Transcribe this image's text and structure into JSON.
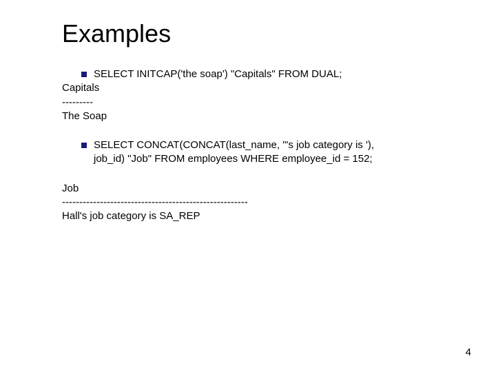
{
  "title": "Examples",
  "block1": {
    "bullet_text": "SELECT INITCAP('the soap') \"Capitals\" FROM DUAL;",
    "line1": "Capitals",
    "line2": "---------",
    "line3": "The Soap"
  },
  "block2": {
    "bullet_line1": "SELECT CONCAT(CONCAT(last_name, \"'s job category is '),",
    "bullet_line2": "job_id) \"Job\" FROM employees WHERE employee_id = 152;",
    "line1": "Job",
    "line2": "------------------------------------------------------",
    "line3": "Hall's job category is SA_REP"
  },
  "page_number": "4"
}
